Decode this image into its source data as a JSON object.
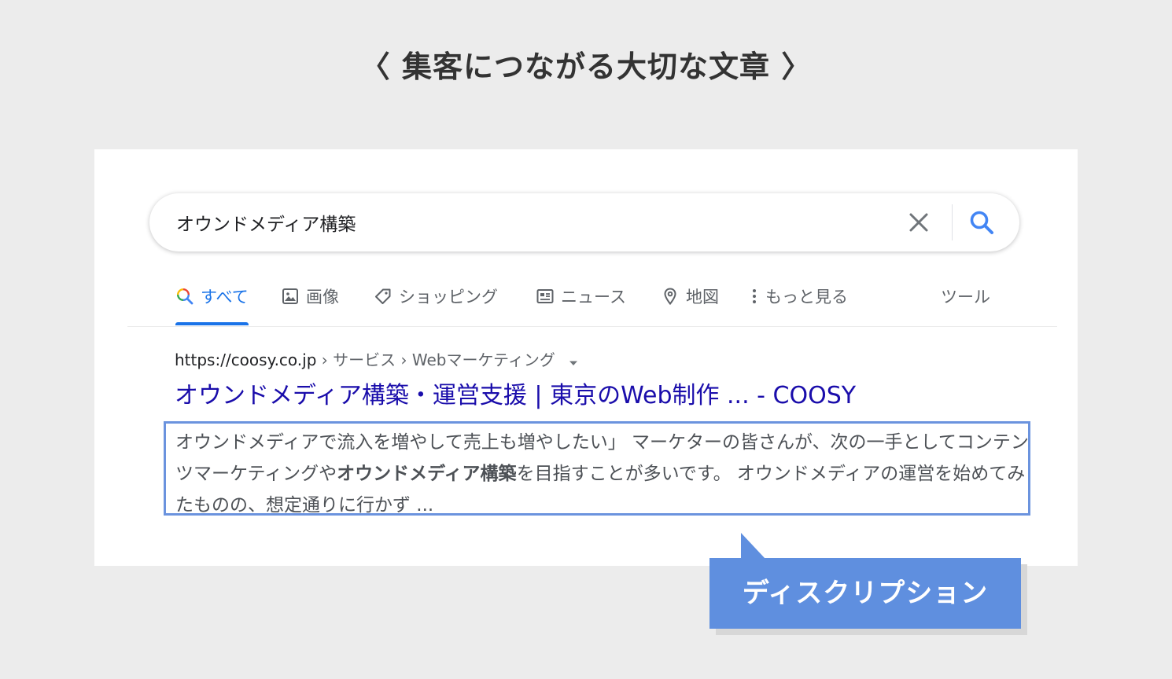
{
  "heading": "〈 集客につながる大切な文章 〉",
  "search": {
    "query": "オウンドメディア構築"
  },
  "tabs": [
    {
      "label": "すべて",
      "icon": "search-icon",
      "active": true
    },
    {
      "label": "画像",
      "icon": "image-icon",
      "active": false
    },
    {
      "label": "ショッピング",
      "icon": "tag-icon",
      "active": false
    },
    {
      "label": "ニュース",
      "icon": "news-icon",
      "active": false
    },
    {
      "label": "地図",
      "icon": "map-pin-icon",
      "active": false
    },
    {
      "label": "もっと見る",
      "icon": "more-vert-icon",
      "active": false
    },
    {
      "label": "ツール",
      "icon": "",
      "active": false
    }
  ],
  "result": {
    "url_domain": "https://coosy.co.jp",
    "url_breadcrumb": " › サービス › Webマーケティング",
    "title": "オウンドメディア構築・運営支援 | 東京のWeb制作 ... - COOSY",
    "desc_part1": "オウンドメディアで流入を増やして売上も増やしたい」 マーケターの皆さんが、次の一手としてコンテンツマーケティングや",
    "desc_bold": "オウンドメディア構築",
    "desc_part2": "を目指すことが多いです。 オウンドメディアの運営を始めてみたものの、想定通りに行かず ..."
  },
  "callout": {
    "label": "ディスクリプション"
  },
  "colors": {
    "accent_blue": "#1a73e8",
    "link_blue": "#1a0dab",
    "highlight_border": "#6b93de",
    "callout_bg": "#5f8fdf"
  }
}
